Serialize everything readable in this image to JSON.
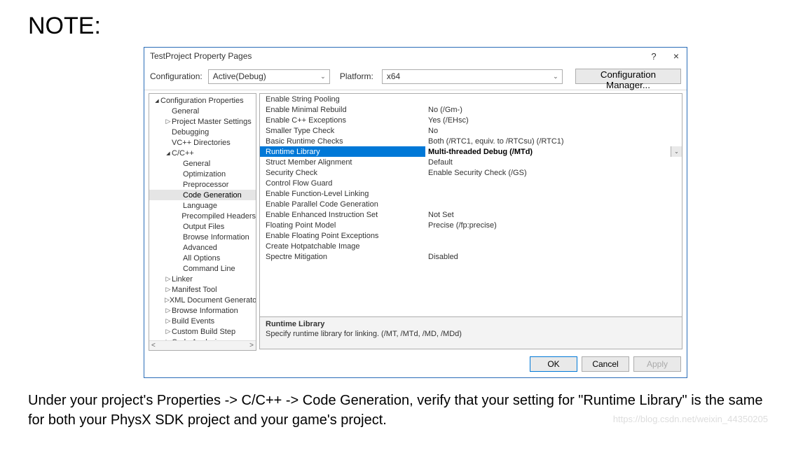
{
  "note_heading": "NOTE:",
  "titlebar": {
    "title": "TestProject Property Pages",
    "help_label": "?",
    "close_label": "×"
  },
  "config_row": {
    "config_label": "Configuration:",
    "config_value": "Active(Debug)",
    "platform_label": "Platform:",
    "platform_value": "x64",
    "cfg_mgr_label": "Configuration Manager..."
  },
  "tree": [
    {
      "label": "Configuration Properties",
      "level": 0,
      "arrow": "open"
    },
    {
      "label": "General",
      "level": 1
    },
    {
      "label": "Project Master Settings",
      "level": 1,
      "arrow": "closed"
    },
    {
      "label": "Debugging",
      "level": 1
    },
    {
      "label": "VC++ Directories",
      "level": 1
    },
    {
      "label": "C/C++",
      "level": 1,
      "arrow": "open"
    },
    {
      "label": "General",
      "level": 2
    },
    {
      "label": "Optimization",
      "level": 2
    },
    {
      "label": "Preprocessor",
      "level": 2
    },
    {
      "label": "Code Generation",
      "level": 2,
      "selected": true
    },
    {
      "label": "Language",
      "level": 2
    },
    {
      "label": "Precompiled Headers",
      "level": 2
    },
    {
      "label": "Output Files",
      "level": 2
    },
    {
      "label": "Browse Information",
      "level": 2
    },
    {
      "label": "Advanced",
      "level": 2
    },
    {
      "label": "All Options",
      "level": 2
    },
    {
      "label": "Command Line",
      "level": 2
    },
    {
      "label": "Linker",
      "level": 1,
      "arrow": "closed"
    },
    {
      "label": "Manifest Tool",
      "level": 1,
      "arrow": "closed"
    },
    {
      "label": "XML Document Generator",
      "level": 1,
      "arrow": "closed"
    },
    {
      "label": "Browse Information",
      "level": 1,
      "arrow": "closed"
    },
    {
      "label": "Build Events",
      "level": 1,
      "arrow": "closed"
    },
    {
      "label": "Custom Build Step",
      "level": 1,
      "arrow": "closed"
    },
    {
      "label": "Code Analysis",
      "level": 1,
      "arrow": "closed"
    }
  ],
  "props": [
    {
      "name": "Enable String Pooling",
      "value": ""
    },
    {
      "name": "Enable Minimal Rebuild",
      "value": "No (/Gm-)"
    },
    {
      "name": "Enable C++ Exceptions",
      "value": "Yes (/EHsc)"
    },
    {
      "name": "Smaller Type Check",
      "value": "No"
    },
    {
      "name": "Basic Runtime Checks",
      "value": "Both (/RTC1, equiv. to /RTCsu) (/RTC1)"
    },
    {
      "name": "Runtime Library",
      "value": "Multi-threaded Debug (/MTd)",
      "selected": true
    },
    {
      "name": "Struct Member Alignment",
      "value": "Default"
    },
    {
      "name": "Security Check",
      "value": "Enable Security Check (/GS)"
    },
    {
      "name": "Control Flow Guard",
      "value": ""
    },
    {
      "name": "Enable Function-Level Linking",
      "value": ""
    },
    {
      "name": "Enable Parallel Code Generation",
      "value": ""
    },
    {
      "name": "Enable Enhanced Instruction Set",
      "value": "Not Set"
    },
    {
      "name": "Floating Point Model",
      "value": "Precise (/fp:precise)"
    },
    {
      "name": "Enable Floating Point Exceptions",
      "value": ""
    },
    {
      "name": "Create Hotpatchable Image",
      "value": ""
    },
    {
      "name": "Spectre Mitigation",
      "value": "Disabled"
    }
  ],
  "desc": {
    "title": "Runtime Library",
    "body": "Specify runtime library for linking.    (/MT, /MTd, /MD, /MDd)"
  },
  "buttons": {
    "ok": "OK",
    "cancel": "Cancel",
    "apply": "Apply"
  },
  "caption": "Under your project's Properties -> C/C++ -> Code Generation, verify that your setting for \"Runtime Library\" is the same for both your PhysX SDK project and your game's project.",
  "watermark": "https://blog.csdn.net/weixin_44350205"
}
